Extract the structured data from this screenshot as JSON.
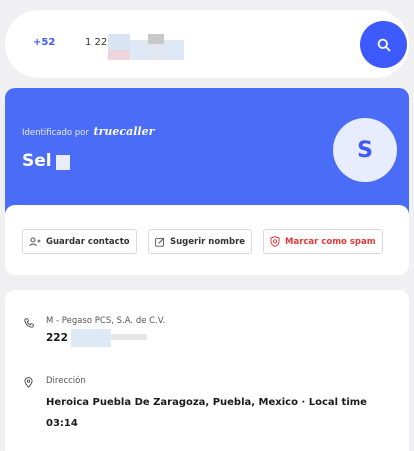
{
  "search": {
    "country_code": "+52",
    "phone_partial": "1 22"
  },
  "profile": {
    "identified_by": "Identificado por",
    "brand": "truecaller",
    "name_partial": "Sel",
    "avatar_initial": "S"
  },
  "actions": {
    "save_contact": "Guardar contacto",
    "suggest_name": "Sugerir nombre",
    "mark_spam": "Marcar como spam"
  },
  "details": {
    "carrier": "M - Pegaso PCS, S.A. de C.V.",
    "phone_partial": "222",
    "address_label": "Dirección",
    "address_value": "Heroica Puebla De Zaragoza, Puebla, Mexico · Local time 03:14"
  },
  "icons": {
    "search": "search-icon",
    "add_contact": "add-contact-icon",
    "edit": "edit-icon",
    "spam": "spam-shield-icon",
    "phone": "phone-icon",
    "location": "location-pin-icon"
  },
  "colors": {
    "accent": "#3d5afe",
    "card_blue": "#4a6cf7",
    "spam_red": "#e53935",
    "background": "#f0f0f3"
  }
}
